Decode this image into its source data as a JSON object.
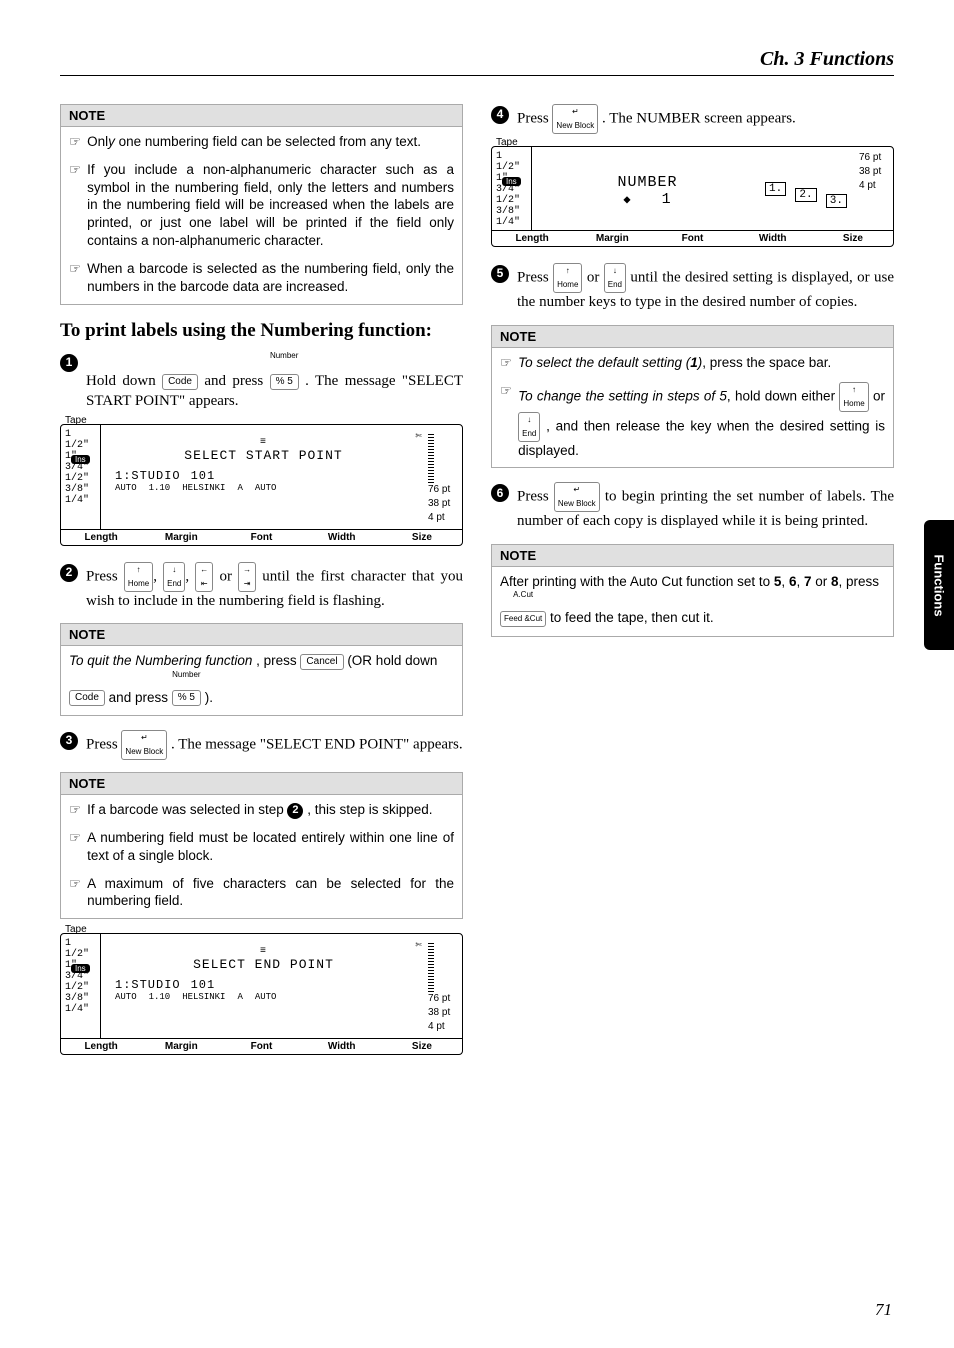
{
  "chapter_heading": "Ch. 3 Functions",
  "side_tab": "Functions",
  "page_number": "71",
  "icons": {
    "pointer": "☞",
    "scissor": "✄",
    "updown": "◆"
  },
  "keys": {
    "code": "Code",
    "cancel": "Cancel",
    "home": "Home",
    "end": "End",
    "left": "←",
    "right": "→",
    "up": "↑",
    "down": "↓",
    "enter": "↵",
    "enter_sub": "New Block",
    "number_super": "Number",
    "percent5": "% 5",
    "feed_super": "A.Cut",
    "feed": "Feed &Cut",
    "ins": "Ins"
  },
  "lcd": {
    "tape_label": "Tape",
    "sizes_left": [
      "1 1/2\"",
      "1\"",
      "3/4\"",
      "1/2\"",
      "3/8\"",
      "1/4\""
    ],
    "sizes_right": [
      "76 pt",
      "38 pt",
      "4 pt"
    ],
    "footer": [
      "Length",
      "Margin",
      "Font",
      "Width",
      "Size"
    ],
    "start": {
      "line1": "SELECT START POINT",
      "line2a": "1:STUDIO",
      "line2b": "101",
      "row3": [
        "AUTO",
        "1.10",
        "HELSINKI",
        "A",
        "AUTO"
      ]
    },
    "end": {
      "line1": "SELECT END POINT",
      "line2a": "1:STUDIO",
      "line2b": "101",
      "row3": [
        "AUTO",
        "1.10",
        "HELSINKI",
        "A",
        "AUTO"
      ]
    },
    "number": {
      "title": "NUMBER",
      "value": "1",
      "box1": "1.",
      "box2": "2.",
      "box3": "3."
    }
  },
  "left": {
    "note1": {
      "head": "NOTE",
      "b1": "Only one numbering field can be selected from any text.",
      "b2": "If you include a non-alphanumeric character such as a symbol in the numbering field, only the letters and numbers in the numbering field will be increased when the labels are printed, or just one label will be printed if the field only contains a non-alphanumeric character.",
      "b3": "When a barcode is selected as the numbering field, only the numbers in the barcode data are increased."
    },
    "heading": "To print labels using the Numbering function:",
    "step1a": "Hold down ",
    "step1b": " and press ",
    "step1c": ". The message \"SELECT START POINT\" appears.",
    "step2a": "Press ",
    "step2b": " or ",
    "step2c": " until the first character that you wish to include in the numbering field is flashing.",
    "note2": {
      "head": "NOTE",
      "line_a": "To quit the Numbering function",
      "line_b": ", press ",
      "line_c": " (OR hold down ",
      "line_d": " and press ",
      "line_e": ")."
    },
    "step3a": "Press ",
    "step3b": ". The message \"SELECT END POINT\" appears.",
    "note3": {
      "head": "NOTE",
      "b1a": "If a barcode was selected in step ",
      "b1b": ", this step is skipped.",
      "b2": "A numbering field must be located entirely within one line of text of a single block.",
      "b3": "A maximum of five characters can be selected for the numbering field."
    }
  },
  "right": {
    "step4a": "Press ",
    "step4b": ". The NUMBER screen appears.",
    "step5a": "Press ",
    "step5b": " or ",
    "step5c": " until the desired setting is displayed, or use the number keys to type in the desired number of copies.",
    "note4": {
      "head": "NOTE",
      "b1a": "To select the default setting (",
      "b1b": "1",
      "b1c": ")",
      "b1d": ", press the space bar.",
      "b2a": "To change the setting in steps of 5",
      "b2b": ", hold down either ",
      "b2c": " or ",
      "b2d": ", and then release the key when the desired setting is displayed."
    },
    "step6a": "Press ",
    "step6b": " to begin printing the set number of labels. The number of each copy is displayed while it is being printed.",
    "note5": {
      "head": "NOTE",
      "line_a": "After printing with the Auto Cut function set to ",
      "v5": "5",
      "c1": ", ",
      "v6": "6",
      "c2": ", ",
      "v7": "7",
      "or": " or ",
      "v8": "8",
      "line_b": ", press ",
      "line_c": " to feed the tape, then cut it."
    }
  }
}
